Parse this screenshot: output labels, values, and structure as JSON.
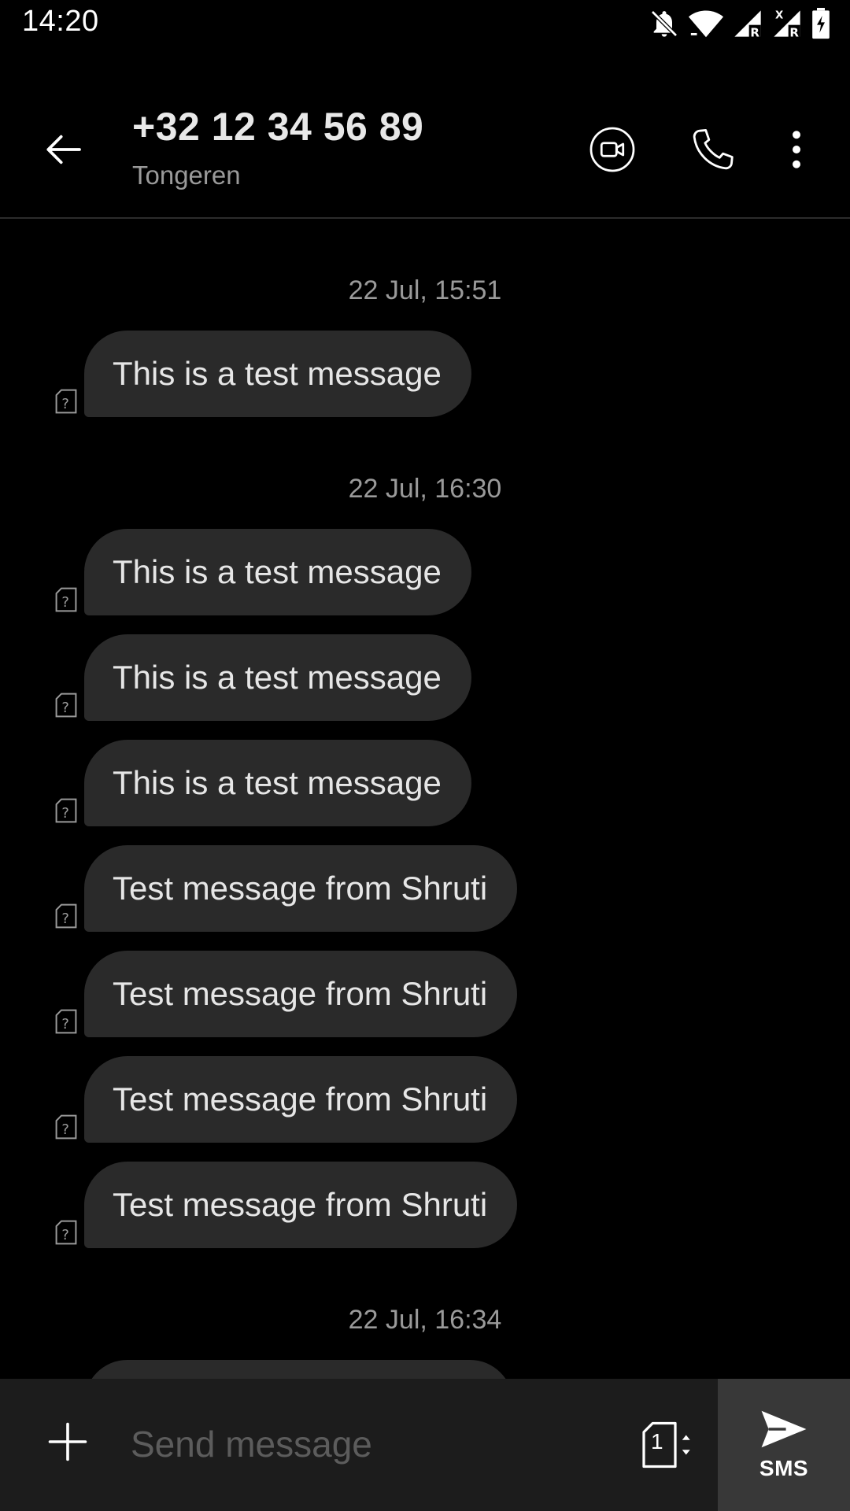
{
  "status_bar": {
    "time": "14:20",
    "icons": [
      "notifications-off-icon",
      "wifi-icon",
      "signal-r-icon",
      "signal-x-r-icon",
      "battery-icon"
    ]
  },
  "header": {
    "title": "+32 12 34 56 89",
    "subtitle": "Tongeren",
    "icons": [
      "back-arrow-icon",
      "video-call-icon",
      "phone-icon",
      "more-vert-icon"
    ]
  },
  "conversation": {
    "groups": [
      {
        "timestamp": "22 Jul, 15:51",
        "messages": [
          "This is a test message"
        ]
      },
      {
        "timestamp": "22 Jul, 16:30",
        "messages": [
          "This is a test message",
          "This is a test message",
          "This is a test message",
          "Test message from Shruti",
          "Test message from Shruti",
          "Test message from Shruti",
          "Test message from Shruti"
        ]
      },
      {
        "timestamp": "22 Jul, 16:34",
        "messages": []
      }
    ]
  },
  "composer": {
    "placeholder": "Send message",
    "sim_slot": "1",
    "send_label": "SMS",
    "icons": [
      "add-icon",
      "sim-card-select-icon",
      "send-icon"
    ]
  },
  "colors": {
    "background": "#000000",
    "bubble": "#2a2a2a",
    "composer": "#1c1c1c",
    "send_button": "#383838",
    "secondary_text": "#9a9a9a"
  }
}
